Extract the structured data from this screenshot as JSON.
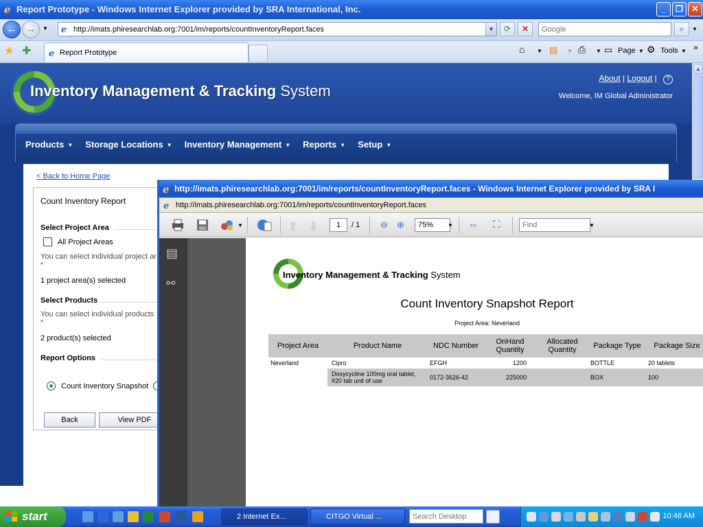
{
  "ie": {
    "window_title": "Report Prototype - Windows Internet Explorer provided by SRA International, Inc.",
    "url": "http://imats.phiresearchlab.org:7001/im/reports/countInventoryReport.faces",
    "search_placeholder": "Google",
    "tab_title": "Report Prototype",
    "cmd_page": "Page",
    "cmd_tools": "Tools",
    "more": "»"
  },
  "site": {
    "title_bold": "Inventory Management & Tracking",
    "title_light": "System",
    "about": "About",
    "logout": "Logout",
    "sep": "|",
    "help": "?",
    "welcome": "Welcome, IM Global Administrator",
    "menu": [
      {
        "label": "Products"
      },
      {
        "label": "Storage Locations"
      },
      {
        "label": "Inventory Management"
      },
      {
        "label": "Reports"
      },
      {
        "label": "Setup"
      }
    ]
  },
  "form": {
    "back_home": "< Back to Home Page",
    "panel_title": "Count Inventory Report",
    "sec_project": "Select Project Area",
    "all_project_areas": "All Project Areas",
    "project_hint": "You can select individual project ar",
    "required": "*",
    "project_count": "1 project area(s) selected",
    "sec_products": "Select Products",
    "products_hint": "You can select individual products",
    "product_count": "2 product(s) selected",
    "sec_options": "Report Options",
    "option_snapshot": "Count Inventory Snapshot",
    "back_button": "Back",
    "view_pdf_button": "View PDF"
  },
  "popup": {
    "title": "http://imats.phiresearchlab.org:7001/im/reports/countInventoryReport.faces - Windows Internet Explorer provided by SRA I",
    "url": "http://imats.phiresearchlab.org:7001/im/reports/countInventoryReport.faces",
    "page_current": "1",
    "page_total": "/ 1",
    "zoom": "75%",
    "find_placeholder": "Find"
  },
  "report": {
    "brand_bold": "Inventory Management & Tracking",
    "brand_light": "System",
    "title": "Count Inventory Snapshot Report",
    "subtitle": "Project Area: Neverland",
    "columns": [
      "Project Area",
      "Product Name",
      "NDC Number",
      "OnHand Quantity",
      "Allocated Quantity",
      "Package Type",
      "Package Size"
    ],
    "rows": [
      {
        "project_area": "Neverland",
        "product": "Cipro",
        "ndc": "EFGH",
        "onhand": "1200",
        "allocated": "",
        "ptype": "BOTTLE",
        "psize": "20 tablets"
      },
      {
        "project_area": "",
        "product": "Doxycycline 100mg oral tablet, #20 tab unit of use",
        "ndc": "0172-3626-42",
        "onhand": "225000",
        "allocated": "",
        "ptype": "BOX",
        "psize": "100"
      }
    ]
  },
  "taskbar": {
    "start": "start",
    "task1": "2 Internet Ex...",
    "task2": "CITGO Virtual ...",
    "search_placeholder": "Search Desktop",
    "clock": "10:48 AM"
  }
}
